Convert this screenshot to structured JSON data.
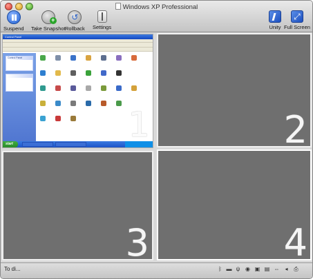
{
  "window": {
    "title": "Windows XP Professional"
  },
  "toolbar": {
    "suspend_label": "Suspend",
    "snapshot_label": "Take Snapshot",
    "rollback_label": "Rollback",
    "settings_label": "Settings",
    "unity_label": "Unity",
    "fullscreen_label": "Full Screen"
  },
  "panes": [
    {
      "number": "1"
    },
    {
      "number": "2"
    },
    {
      "number": "3"
    },
    {
      "number": "4"
    }
  ],
  "guest": {
    "start_label": "start",
    "window_title": "Control Panel",
    "sidebar_heading": "Control Panel"
  },
  "status": {
    "text": "To di..."
  },
  "icons": [
    "bluetooth-icon",
    "floppy-icon",
    "usb-icon",
    "cd-icon",
    "disk-icon",
    "network-icon",
    "shared-folder-icon",
    "audio-icon",
    "printer-icon"
  ],
  "colors": {
    "pane_gray": "#6f6f6f",
    "xp_blue": "#1d54c8",
    "xp_green": "#2a8a2a"
  }
}
